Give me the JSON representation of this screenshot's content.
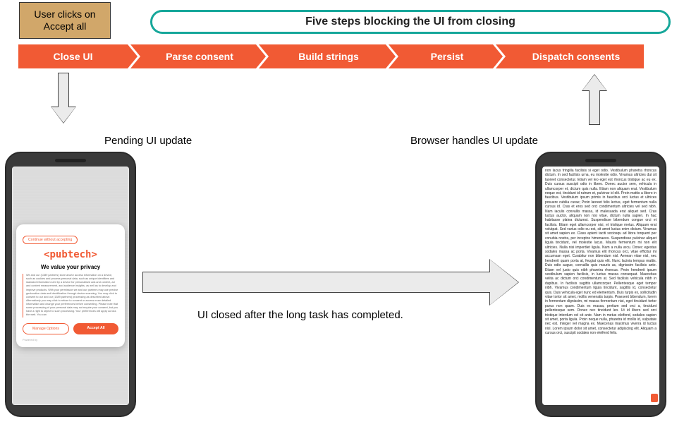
{
  "header": {
    "user_clicks": "User clicks on Accept all",
    "banner": "Five steps blocking the UI from closing"
  },
  "steps": {
    "s1": "Close UI",
    "s2": "Parse consent",
    "s3": "Build strings",
    "s4": "Persist",
    "s5": "Dispatch consents"
  },
  "labels": {
    "pending": "Pending UI update",
    "browser": "Browser handles UI update",
    "closed": "UI closed after the long task has completed."
  },
  "dialog": {
    "continue_without": "Continue without accepting",
    "logo_left": "<",
    "logo_text": "pubtech",
    "logo_right": ">",
    "title": "We value your privacy",
    "body": "We and our (1389 partners) store and/or access information on a device, such as cookies and process personal data, such as unique identifiers and standard information sent by a device for personalised ads and content, ad and content measurement, and audience insights, as well as to develop and improve products. With your permission we and our partners may use precise geolocation data and identification through device scanning. You may click to consent to our and our (1389 partners) processing as described above. Alternatively you may click to refuse to consent or access more detailed information and change your preferences before consenting. Please note that some processing of your personal data may not require your consent, but you have a right to object to such processing. Your preferences will apply across the web. You can",
    "manage": "Manage Options",
    "accept": "Accept All",
    "powered": "Powered by"
  },
  "phone2": {
    "lorem": "non lacus fringilla facilisis si eget odio. Vestibulum pharetra rhoncus dictum. In sed facilisis urna, eu molestie odio. Vivamus ultricies dui sit laoreet consectetur. Etiam vel leo eget est rhoncus tristique ac eu ex. Duis cursus suscipit odio in libero. Donec auctor sem, vehicula in ullamcorper et, dictum quis nulla. Etiam non aliquam erat. Vestibulum neque est, tincidunt id rutrum et, pulvinar id elit. Proin mattis a libero in faucibus. Vestibulum ipsum primis in faucibus orci luctus et ultrices posuere cubilia curae; Proin laoreet felis lectus, eget fermentum nulla cursus id. Cras et eros sed orci condimentum ultricies vel sed nibh. Nam iaculis convallis massa, id malesuada erat aliquet sed. Cras luctus auctor, aliquam non nisi vitae, dictum nulla sapien. In hac habitasse platea dictumst. Suspendisse bibendum congue orci et facilisis. Etiam eget ullamcorper nisi, et tristique metus. Aliquam erat volutpat. Sed varius odio eu est, sit amet luctus enim dictum. Vivamus sit amet sapien ex. Class aptent taciti sociosqu ad litora torquent per conubia nostra, per inceptos himenaeos. Suspendisse pulvinar aliquet ligula tincidunt, vel molestie lacus. Mauris fermentum mi non elit ultricies. Nulla nisi imperdiet ligula. Nam a nulla arcu. Donec egestas sodales massa ac porta. Vivamus elit rhoncus orci, vitae efficitur mi accumsan eget. Curabitur non bibendum nisl. Aenean vitae nisl, nec hendrerit quam porta at, feugiat quis elit. Nunc lacinia tempus mattis. Duis odio augue, convallis quis mauris ac, dignissim facilisis ante. Etiam vel justo quis nibh pharetra rhoncus. Proin hendrerit ipsum vestibulum sapien facilisis, in luctus massa consequat. Maecebus velita ac dictum orci condimentum at. Sed facilisis vehicula nibh in dapibus. In facilisis sagittis ullamcorper. Pellentesque eget tempor nibh. Vivamus condimentum ligula tincidunt, sagittis id, consectetur quis. Duis vehicula eget nunc ed elementum. Duis turpis ex, sollicitudin vitae tortor sit amet, mollis venenatis turpis. Praesent bibendum, lorem in fermentum dignissim, mi massa fermentum nisi, eget tincidunt tortor purus non quam. Duis ex massa, pretium sed orci a, tincidunt pellentesque sem. Donec nec tincidunt leo. Ut id libero sed orci tristique interdum vel sit ante. Nam in metus eleifend, sodales sapien sit amet, porta ligula. Proin neque nulla, pharetra id mollis id, vulputate nec est. Integer vel magna ex. Maecenas maximus viverra id luctus nisl. Lorem ipsum dolor sit amet, consectetur adipiscing elit. Aliquam a cursus orci, suscipit sodales non eleifend felis."
  }
}
